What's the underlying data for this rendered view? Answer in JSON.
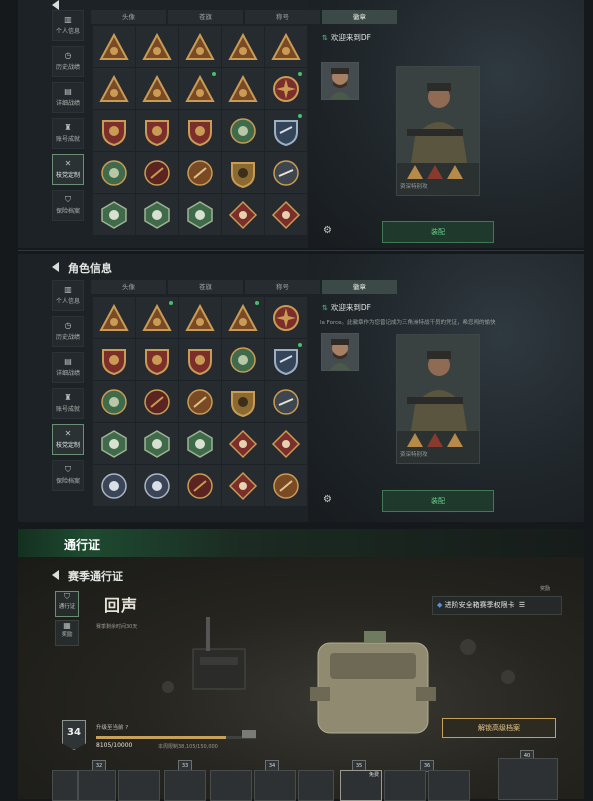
{
  "top_panel": {
    "nav": [
      {
        "label": "个人信息",
        "icon": "bar-chart-icon"
      },
      {
        "label": "历史战绩",
        "icon": "history-icon"
      },
      {
        "label": "详细战绩",
        "icon": "folder-icon"
      },
      {
        "label": "账号成就",
        "icon": "trophy-icon"
      },
      {
        "label": "枝党定制",
        "icon": "tools-icon"
      },
      {
        "label": "保险档案",
        "icon": "shield-icon"
      }
    ],
    "tabs": [
      "头像",
      "苍旗",
      "称号",
      "徽章"
    ],
    "greeting": "欢迎来到DF",
    "card_name": "资深特别攻",
    "equip_label": "装配"
  },
  "mid_panel": {
    "title": "角色信息",
    "nav": [
      {
        "label": "个人信息",
        "icon": "bar-chart-icon"
      },
      {
        "label": "历史战绩",
        "icon": "history-icon"
      },
      {
        "label": "详细战绩",
        "icon": "folder-icon"
      },
      {
        "label": "账号成就",
        "icon": "trophy-icon"
      },
      {
        "label": "枝党定制",
        "icon": "tools-icon"
      },
      {
        "label": "保险档案",
        "icon": "shield-icon"
      }
    ],
    "tabs": [
      "头像",
      "苍旗",
      "称号",
      "徽章"
    ],
    "greeting": "欢迎来到DF",
    "description": "la Force。此徽章作为您曾记成为三角洲特战干员的凭证，希您闯的愉快",
    "card_name": "资深特别攻",
    "equip_label": "装配"
  },
  "pass": {
    "banner_title": "通行证",
    "season_title": "赛季通行证",
    "nav": [
      {
        "label": "通行证",
        "icon": "pass-icon"
      },
      {
        "label": "奖励",
        "icon": "grid-icon"
      }
    ],
    "season_logo": "回声",
    "season_sub": "赛季剩余时间30天",
    "upgrade_title": "进阶安全箱赛季权限卡",
    "upgrade_hint": "奖励",
    "level": "34",
    "xp_label": "升级至当前",
    "xp_value": "8105/10000",
    "xp_fraction": 0.81,
    "week_limit": "本周限制38,105/150,000",
    "unlock_label": "解锁高级档案",
    "reward_levels": [
      "32",
      "33",
      "34",
      "35",
      "36",
      "40"
    ],
    "reward_tag": "免费"
  },
  "colors": {
    "accent_green": "#47c06a",
    "gold": "#c7a15a",
    "badge_brown": "#7a4a24",
    "badge_gold": "#c99b55",
    "badge_green": "#3f6b4b",
    "badge_red": "#7c2f2a"
  },
  "badges_top": [
    [
      "gold-triangle",
      "gold-triangle",
      "gold-triangle",
      "gold-triangle",
      "gold-triangle"
    ],
    [
      "gold-triangle",
      "gold-triangle",
      "gold-triangle",
      "gold-triangle",
      "medal-cross"
    ],
    [
      "red-shield",
      "red-shield",
      "red-shield",
      "green-circle",
      "blue-shield"
    ],
    [
      "green-circle",
      "red-circle",
      "brown-circle",
      "gold-shield",
      "gold-circle"
    ],
    [
      "green-hex",
      "green-hex",
      "green-hex",
      "red-diamond",
      "red-diamond"
    ]
  ],
  "badges_mid": [
    [
      "gold-triangle",
      "gold-triangle",
      "gold-triangle",
      "gold-triangle",
      "medal-cross"
    ],
    [
      "red-shield",
      "red-shield",
      "red-shield",
      "green-circle",
      "blue-shield"
    ],
    [
      "green-circle",
      "red-circle",
      "brown-circle",
      "gold-shield",
      "gold-circle"
    ],
    [
      "green-hex",
      "green-hex",
      "green-hex",
      "red-diamond",
      "red-diamond"
    ],
    [
      "blue-circle",
      "blue-circle",
      "red-circle",
      "red-diamond",
      "brown-circle"
    ]
  ]
}
